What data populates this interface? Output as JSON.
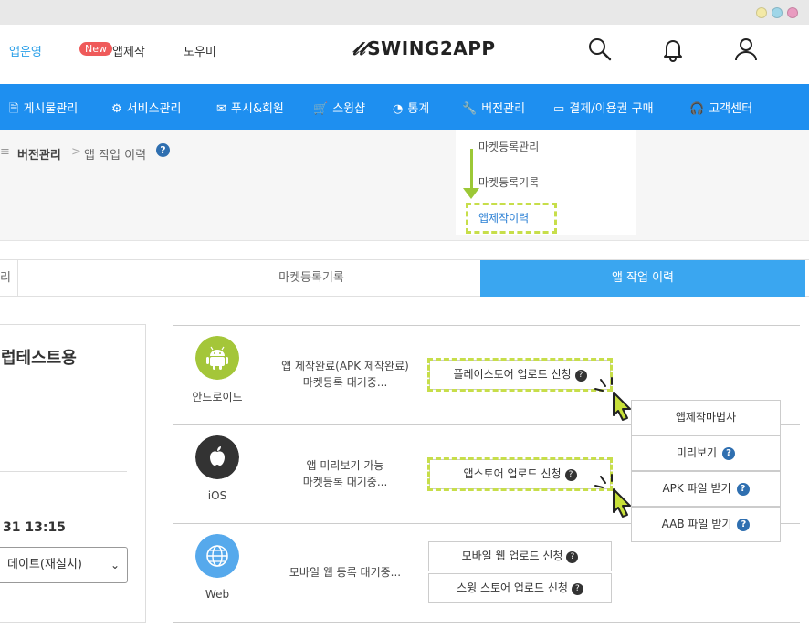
{
  "header": {
    "nav": [
      "앱운영",
      "앱제작",
      "도우미"
    ],
    "new_badge": "New",
    "logo_text": "SWING2APP",
    "logo_mark": "𝓁𝓁"
  },
  "bluenav": [
    {
      "icon": "document-icon",
      "label": "게시물관리"
    },
    {
      "icon": "gear-icon",
      "label": "서비스관리"
    },
    {
      "icon": "mail-icon",
      "label": "푸시&회원"
    },
    {
      "icon": "cart-icon",
      "label": "스윙샵"
    },
    {
      "icon": "pie-chart-icon",
      "label": "통계"
    },
    {
      "icon": "wrench-icon",
      "label": "버전관리"
    },
    {
      "icon": "credit-card-icon",
      "label": "결제/이용권 구매"
    },
    {
      "icon": "headset-icon",
      "label": "고객센터"
    }
  ],
  "breadcrumb": {
    "prefix": "≡",
    "section": "버전관리",
    "separator": ">",
    "current": "앱 작업 이력",
    "help": "?"
  },
  "dropdown": [
    "마켓등록관리",
    "마켓등록기록",
    "앱제작이력"
  ],
  "tabs": [
    "리",
    "마켓등록기록",
    "앱 작업 이력"
  ],
  "left_card": {
    "title": "럽테스트용",
    "date": "31 13:15",
    "select_value": "데이트(재설치)"
  },
  "platforms": [
    {
      "name": "안드로이드",
      "status": [
        "앱 제작완료(APK 제작완료)",
        "마켓등록 대기중..."
      ],
      "buttons": [
        "플레이스토어 업로드 신청"
      ]
    },
    {
      "name": "iOS",
      "status": [
        "앱 미리보기 가능",
        "마켓등록 대기중..."
      ],
      "buttons": [
        "앱스토어 업로드 신청"
      ]
    },
    {
      "name": "Web",
      "status": [
        "모바일 웹 등록 대기중..."
      ],
      "buttons": [
        "모바일 웹 업로드 신청",
        "스윙 스토어 업로드 신청"
      ]
    }
  ],
  "action_menu": [
    "앱제작마법사",
    "미리보기",
    "APK 파일 받기",
    "AAB 파일 받기"
  ],
  "colors": {
    "nav_blue": "#1e8ff0",
    "tab_active": "#3aa6f0",
    "android_green": "#a4c639",
    "highlight_dash": "#c7de4a",
    "new_badge": "#ef5a5a"
  }
}
